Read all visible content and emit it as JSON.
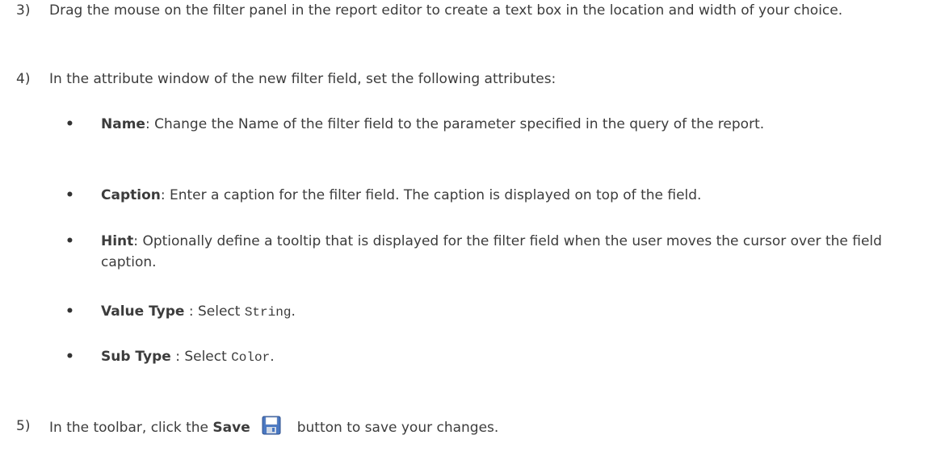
{
  "step3": {
    "number": "3)",
    "text": "Drag the mouse on the filter panel in the report editor to create a text box in the location and width of your choice."
  },
  "step4": {
    "number": "4)",
    "text": "In the attribute window of the new filter field, set the following attributes:"
  },
  "bullets": [
    {
      "marker": "•",
      "term": "Name",
      "sep": ": ",
      "text": "Change the Name of the filter field to the parameter specified in the query of the report."
    },
    {
      "marker": "•",
      "term": "Caption",
      "sep": ": ",
      "text": "Enter a caption for the filter field. The caption is displayed on top of the field."
    },
    {
      "marker": "•",
      "term": "Hint",
      "sep": ": ",
      "text": "Optionally define a tooltip that is displayed for the filter field when the user moves the cursor over the field caption."
    },
    {
      "marker": "•",
      "term": "Value Type",
      "sep": " : Select ",
      "code": "String",
      "end": "."
    },
    {
      "marker": "•",
      "term": "Sub Type",
      "sep": " : Select ",
      "code": "Color",
      "end": "."
    }
  ],
  "step5": {
    "number": "5)",
    "prefix": "In the toolbar, click the ",
    "bold": "Save",
    "icon": "save-icon",
    "suffix": "button to save your changes."
  },
  "colors": {
    "text": "#3c3c3c",
    "icon_blue": "#4a78c2"
  }
}
